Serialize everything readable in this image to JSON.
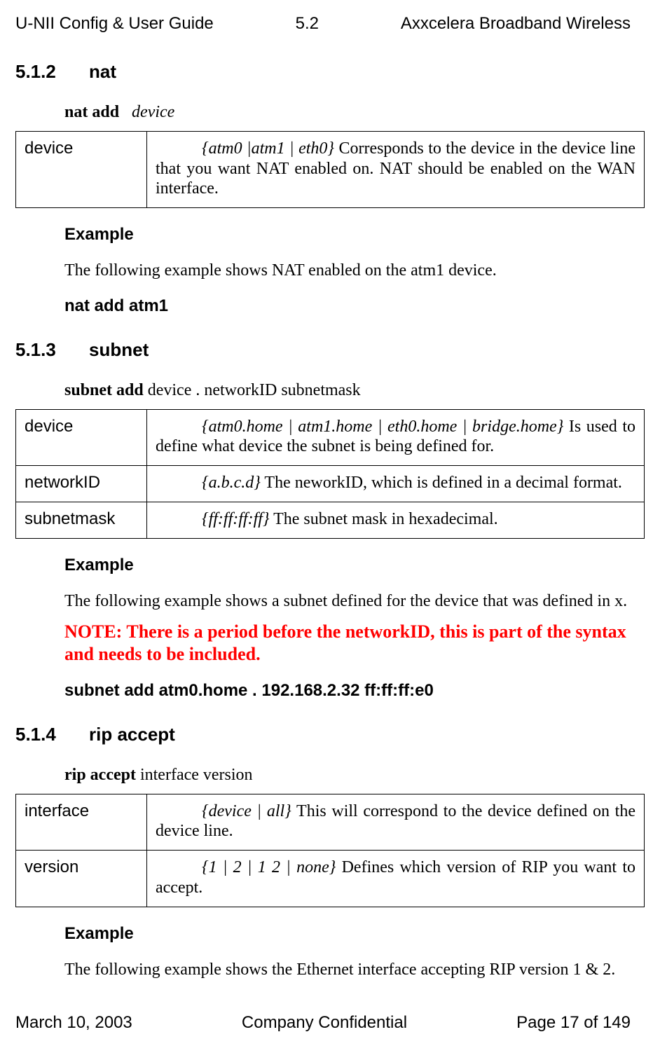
{
  "header": {
    "left": "U-NII Config & User Guide",
    "center": "5.2",
    "right": "Axxcelera Broadband Wireless"
  },
  "footer": {
    "left": "March 10, 2003",
    "center": "Company Confidential",
    "right": "Page 17 of 149"
  },
  "s512": {
    "num": "5.1.2",
    "title": "nat",
    "syntax_bold": "nat   add",
    "syntax_ital": "device",
    "table": {
      "row1": {
        "term": "device",
        "ital": "{atm0 |atm1 | eth0}",
        "rest": " Corresponds to the device in the device line that you want NAT enabled on. NAT should be enabled on the WAN interface."
      }
    },
    "example_head": "Example",
    "example_text": "The following example shows NAT enabled on the atm1 device.",
    "example_cmd": "nat   add   atm1"
  },
  "s513": {
    "num": "5.1.3",
    "title": "subnet",
    "syntax_bold": "subnet   add",
    "syntax_rest": "   device   .   networkID   subnetmask",
    "table": {
      "r1": {
        "term": "device",
        "ital": "{atm0.home | atm1.home | eth0.home | bridge.home}",
        "rest": " Is used to define what device the subnet is being defined for."
      },
      "r2": {
        "term": "networkID",
        "ital": "{a.b.c.d}",
        "rest": " The neworkID, which is defined in a decimal format."
      },
      "r3": {
        "term": "subnetmask",
        "ital": "{ff:ff:ff:ff}",
        "rest": " The subnet mask in hexadecimal."
      }
    },
    "example_head": "Example",
    "example_text": "The following example shows a subnet defined for the device that was defined in x.",
    "note": "NOTE: There is a period before the networkID, this is part of the syntax and needs to be included.",
    "example_cmd": "subnet   add   atm0.home   .   192.168.2.32   ff:ff:ff:e0"
  },
  "s514": {
    "num": "5.1.4",
    "title": "rip accept",
    "syntax_bold": "rip   accept",
    "syntax_rest": "   interface   version",
    "table": {
      "r1": {
        "term": "interface",
        "ital": "{device | all}",
        "rest": " This will correspond to the device defined on the device line."
      },
      "r2": {
        "term": "version",
        "ital": "{1 | 2 | 1 2 | none}",
        "rest": " Defines which version of RIP you want to accept."
      }
    },
    "example_head": "Example",
    "example_text": "The following example shows the Ethernet interface accepting RIP version 1 & 2."
  }
}
